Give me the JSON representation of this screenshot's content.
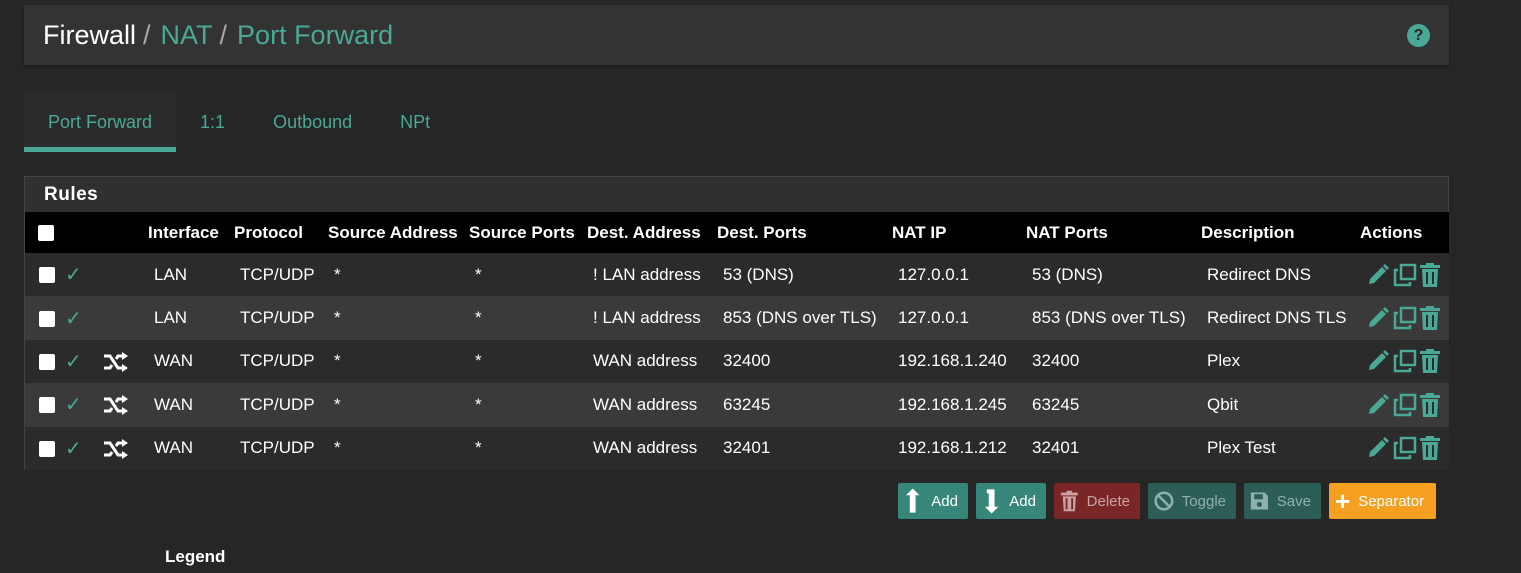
{
  "breadcrumb": {
    "first": "Firewall",
    "second": "NAT",
    "third": "Port Forward",
    "sep": "/"
  },
  "tabs": [
    {
      "label": "Port Forward",
      "active": true
    },
    {
      "label": "1:1",
      "active": false
    },
    {
      "label": "Outbound",
      "active": false
    },
    {
      "label": "NPt",
      "active": false
    }
  ],
  "panel": {
    "title": "Rules"
  },
  "columns": {
    "interface": "Interface",
    "protocol": "Protocol",
    "source_address": "Source Address",
    "source_ports": "Source Ports",
    "dest_address": "Dest. Address",
    "dest_ports": "Dest. Ports",
    "nat_ip": "NAT IP",
    "nat_ports": "NAT Ports",
    "description": "Description",
    "actions": "Actions"
  },
  "rows": [
    {
      "enabled": true,
      "linked": false,
      "interface": "LAN",
      "protocol": "TCP/UDP",
      "source_address": "*",
      "source_ports": "*",
      "dest_address": "! LAN address",
      "dest_ports": "53 (DNS)",
      "nat_ip": "127.0.0.1",
      "nat_ports": "53 (DNS)",
      "description": "Redirect DNS"
    },
    {
      "enabled": true,
      "linked": false,
      "interface": "LAN",
      "protocol": "TCP/UDP",
      "source_address": "*",
      "source_ports": "*",
      "dest_address": "! LAN address",
      "dest_ports": "853 (DNS over TLS)",
      "nat_ip": "127.0.0.1",
      "nat_ports": "853 (DNS over TLS)",
      "description": "Redirect DNS TLS"
    },
    {
      "enabled": true,
      "linked": true,
      "interface": "WAN",
      "protocol": "TCP/UDP",
      "source_address": "*",
      "source_ports": "*",
      "dest_address": "WAN address",
      "dest_ports": "32400",
      "nat_ip": "192.168.1.240",
      "nat_ports": "32400",
      "description": "Plex"
    },
    {
      "enabled": true,
      "linked": true,
      "interface": "WAN",
      "protocol": "TCP/UDP",
      "source_address": "*",
      "source_ports": "*",
      "dest_address": "WAN address",
      "dest_ports": "63245",
      "nat_ip": "192.168.1.245",
      "nat_ports": "63245",
      "description": "Qbit"
    },
    {
      "enabled": true,
      "linked": true,
      "interface": "WAN",
      "protocol": "TCP/UDP",
      "source_address": "*",
      "source_ports": "*",
      "dest_address": "WAN address",
      "dest_ports": "32401",
      "nat_ip": "192.168.1.212",
      "nat_ports": "32401",
      "description": "Plex Test"
    }
  ],
  "buttons": {
    "add_top": "Add",
    "add_bottom": "Add",
    "delete": "Delete",
    "toggle": "Toggle",
    "save": "Save",
    "separator": "Separator"
  },
  "legend": {
    "title": "Legend"
  },
  "colors": {
    "accent": "#4aa996",
    "orange": "#f5a020",
    "danger": "#7a2626"
  }
}
